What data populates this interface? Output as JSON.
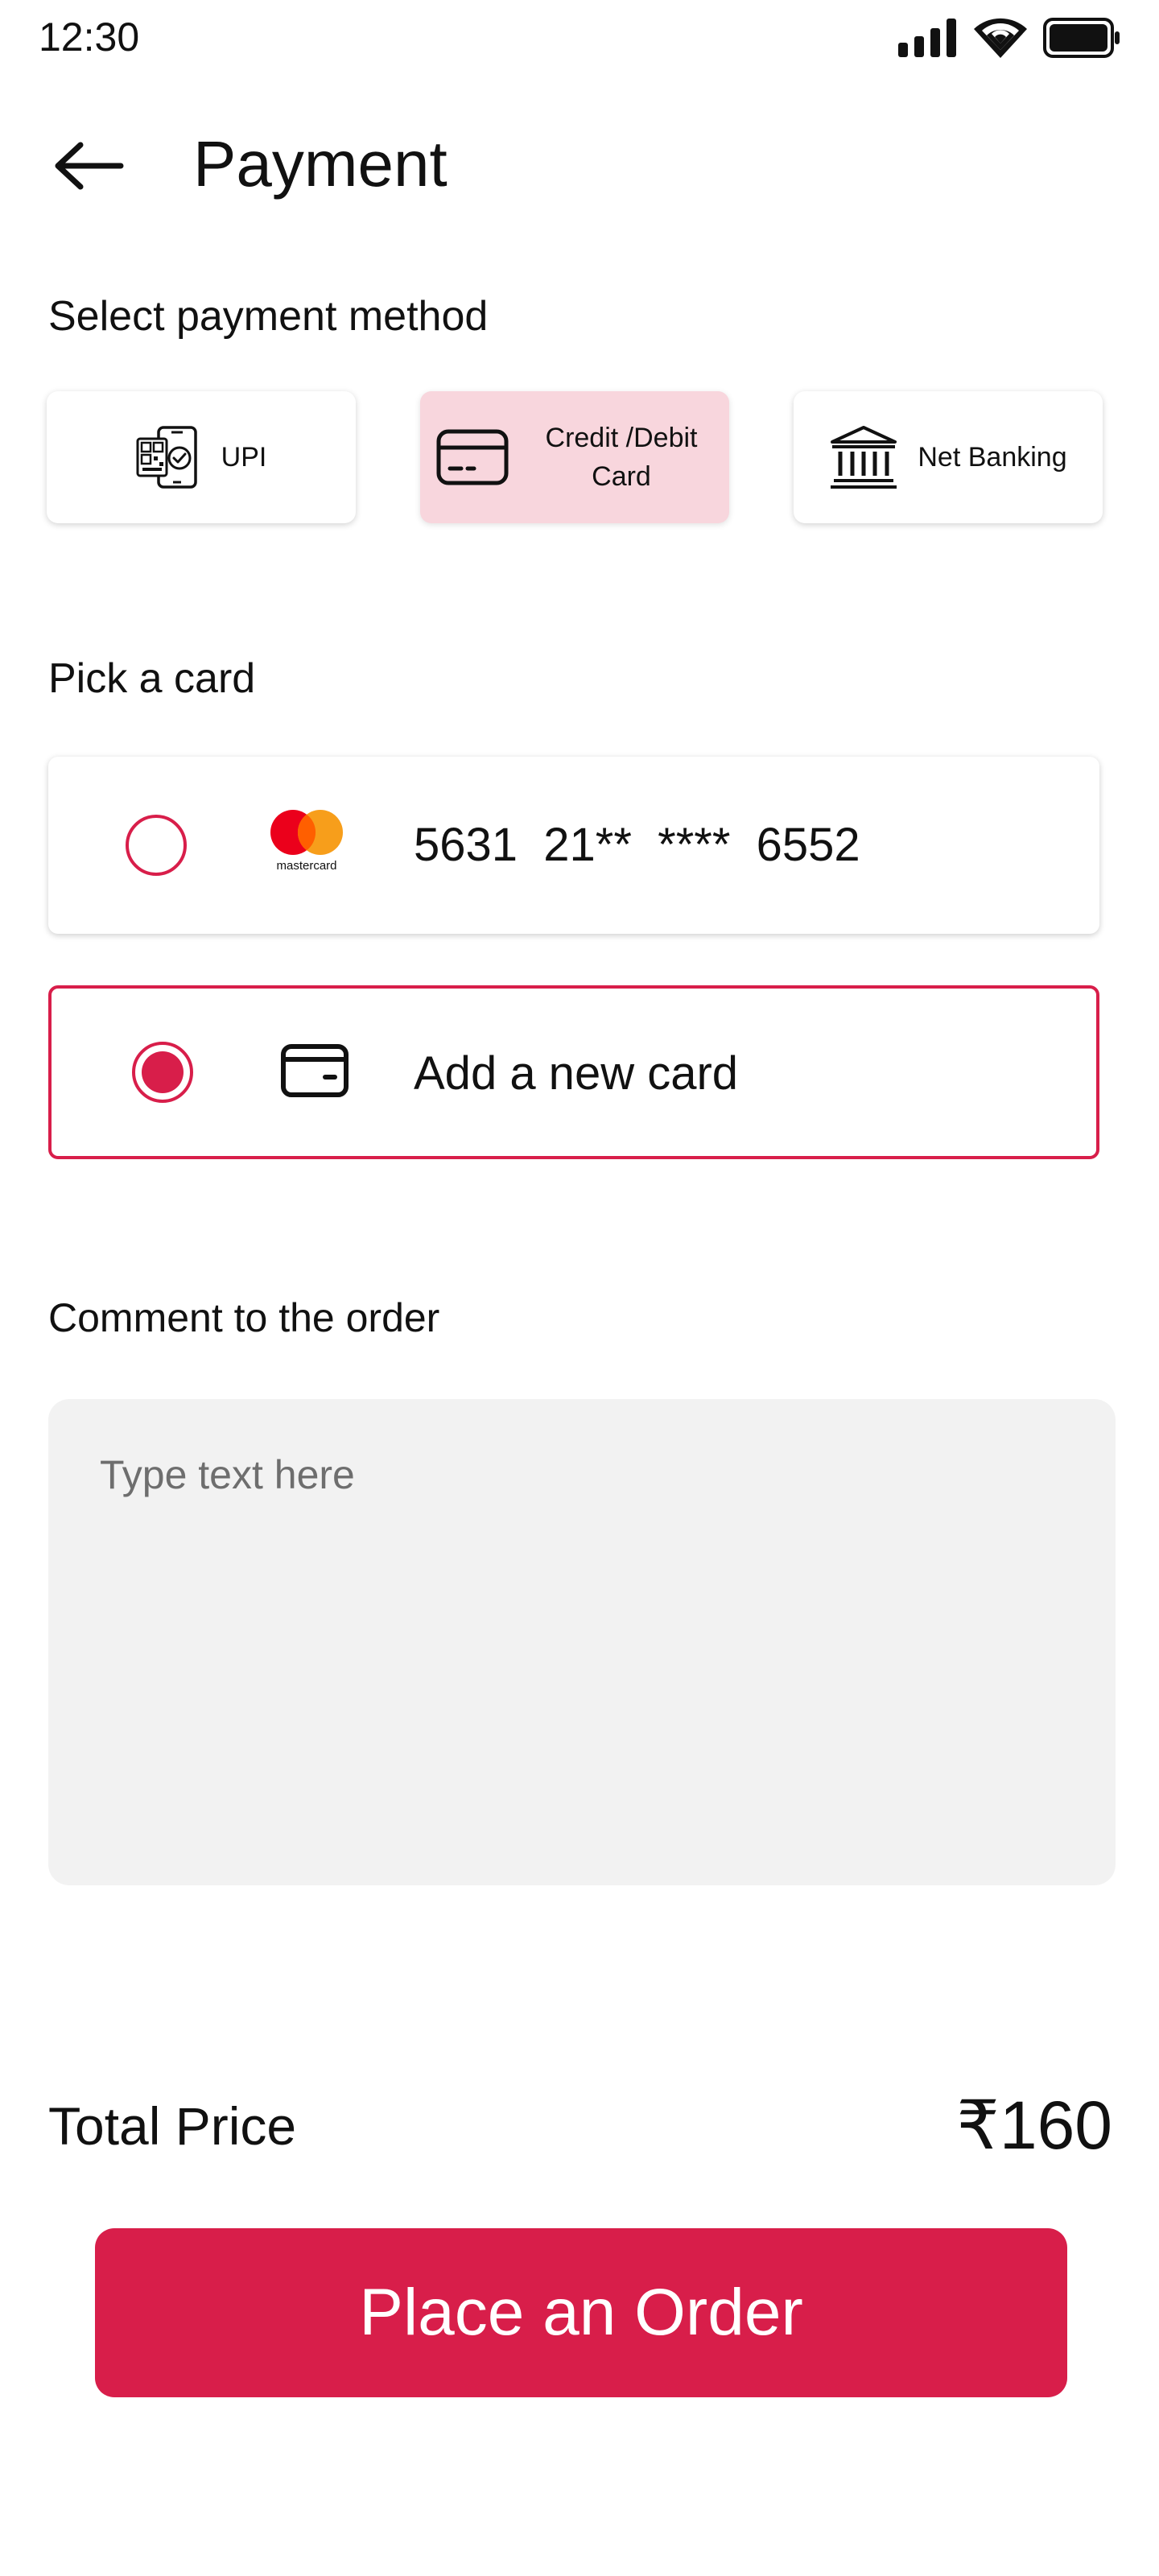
{
  "status_bar": {
    "time": "12:30"
  },
  "header": {
    "title": "Payment"
  },
  "payment_methods": {
    "label": "Select payment method",
    "options": [
      {
        "label": "UPI",
        "icon": "upi-phone-qr-icon",
        "selected": false
      },
      {
        "label": "Credit /Debit Card",
        "icon": "credit-card-icon",
        "selected": true
      },
      {
        "label": "Net Banking",
        "icon": "bank-icon",
        "selected": false
      }
    ]
  },
  "cards": {
    "label": "Pick a card",
    "saved_card": {
      "number": "5631  21**  ****  6552",
      "brand_text": "mastercard",
      "checked": false
    },
    "new_card": {
      "label": "Add a new card",
      "checked": true
    }
  },
  "comment": {
    "label": "Comment to the order",
    "placeholder": "Type text here",
    "value": ""
  },
  "total": {
    "label": "Total Price",
    "value": "₹160"
  },
  "cta": {
    "label": "Place an Order"
  },
  "colors": {
    "accent": "#d81e4a",
    "selected_bg": "#f8d6dd",
    "input_bg": "#f2f2f2"
  }
}
